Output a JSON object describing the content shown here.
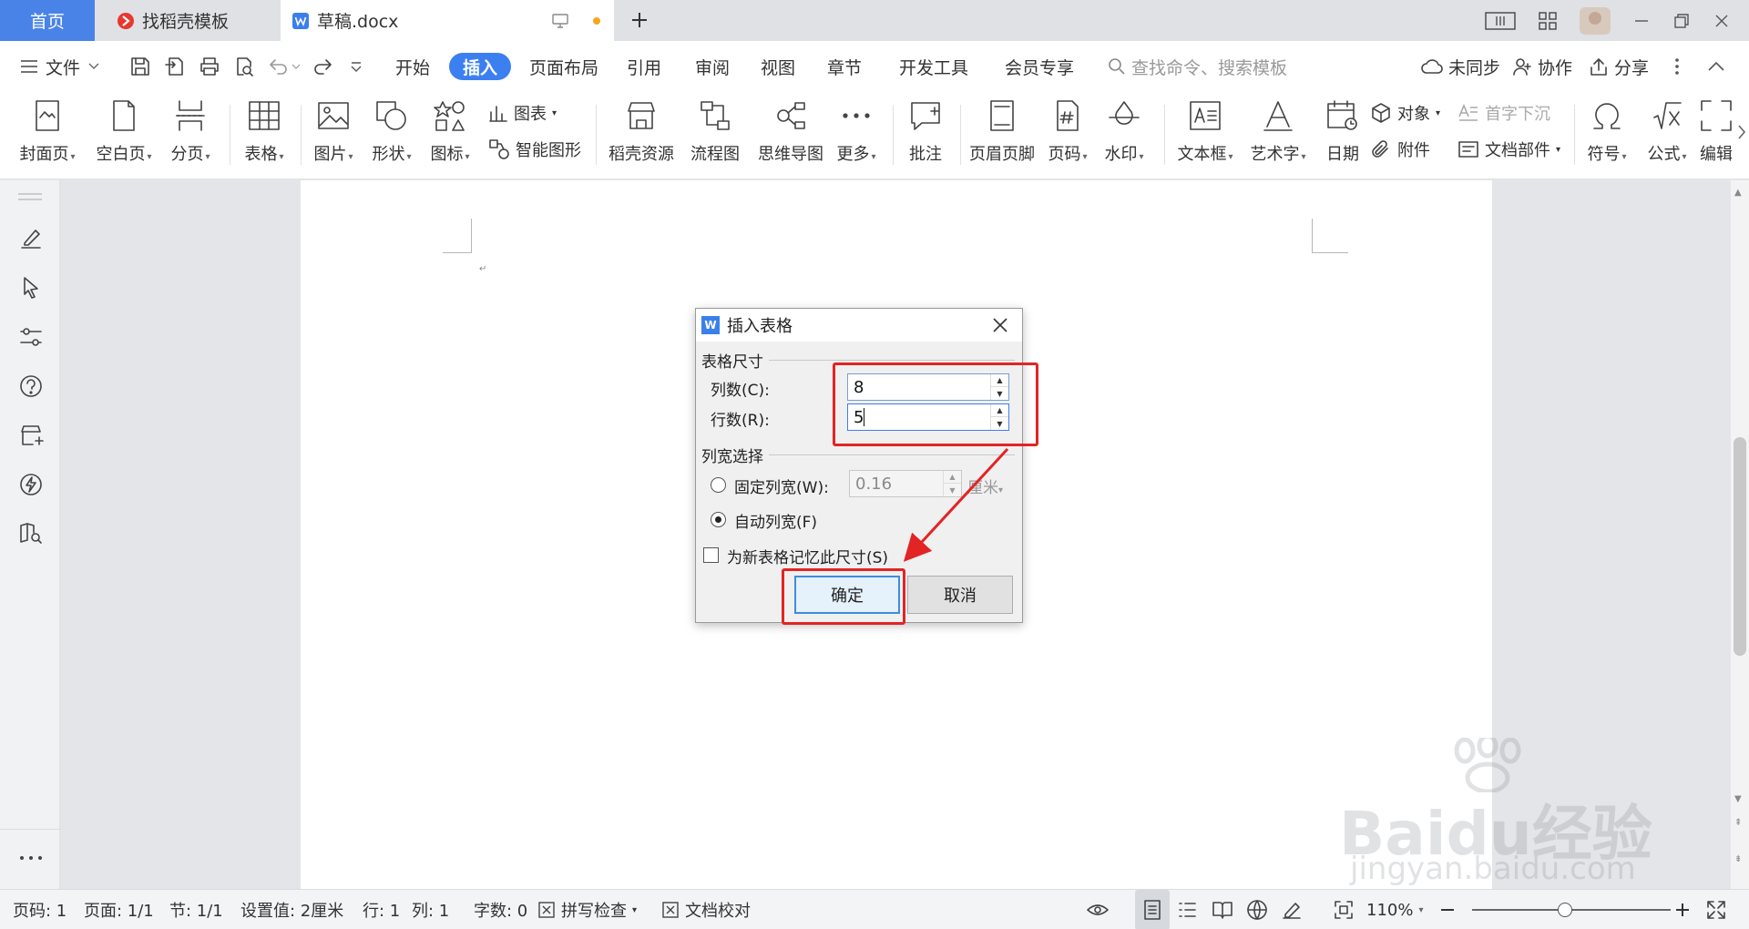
{
  "tabs": {
    "home": "首页",
    "templates": "找稻壳模板",
    "document": "草稿.docx"
  },
  "menu": {
    "file": "文件",
    "start": "开始",
    "insert": "插入",
    "page_layout": "页面布局",
    "references": "引用",
    "review": "审阅",
    "view": "视图",
    "chapter": "章节",
    "dev_tools": "开发工具",
    "member": "会员专享",
    "search_placeholder": "查找命令、搜索模板",
    "sync": "未同步",
    "collab": "协作",
    "share": "分享"
  },
  "ribbon": {
    "cover": "封面页",
    "blank": "空白页",
    "page_break": "分页",
    "table": "表格",
    "picture": "图片",
    "shape": "形状",
    "icon": "图标",
    "chart": "图表",
    "smart_art": "智能图形",
    "daoke": "稻壳资源",
    "flowchart": "流程图",
    "mindmap": "思维导图",
    "more": "更多",
    "comment": "批注",
    "header_footer": "页眉页脚",
    "page_number": "页码",
    "watermark": "水印",
    "textbox": "文本框",
    "wordart": "艺术字",
    "date": "日期",
    "object": "对象",
    "drop_cap": "首字下沉",
    "attachment": "附件",
    "doc_parts": "文档部件",
    "symbol": "符号",
    "formula": "公式",
    "edit": "编辑"
  },
  "dialog": {
    "title": "插入表格",
    "size_section": "表格尺寸",
    "columns_label": "列数(C):",
    "columns_value": "8",
    "rows_label": "行数(R):",
    "rows_value": "5",
    "width_section": "列宽选择",
    "fixed_width_label": "固定列宽(W):",
    "fixed_width_value": "0.16",
    "unit": "厘米",
    "auto_width_label": "自动列宽(F)",
    "auto_width_selected": true,
    "remember_label": "为新表格记忆此尺寸(S)",
    "remember_checked": false,
    "ok": "确定",
    "cancel": "取消"
  },
  "status": {
    "page_num": "页码: 1",
    "pages": "页面: 1/1",
    "section": "节: 1/1",
    "setting": "设置值: 2厘米",
    "row": "行: 1",
    "col": "列: 1",
    "words": "字数: 0",
    "spellcheck": "拼写检查",
    "proofread": "文档校对",
    "zoom": "110%"
  },
  "watermark": {
    "brand": "Bai",
    "brand_tail": "du",
    "cn": "经验",
    "url": "jingyan.baidu.com"
  },
  "colors": {
    "accent": "#3c7ff0",
    "highlight": "#e32424",
    "tab_home": "#4a83e8"
  }
}
